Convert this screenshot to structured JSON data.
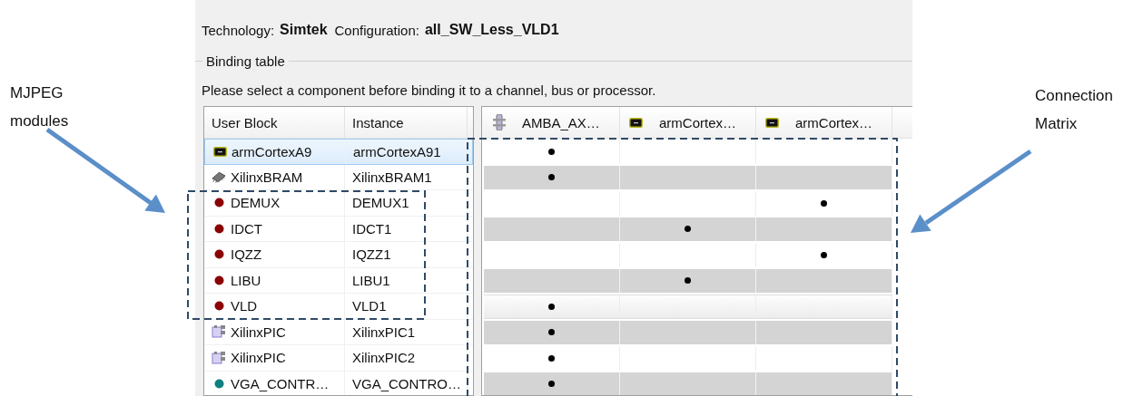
{
  "technology": {
    "label": "Technology:",
    "value": "Simtek"
  },
  "configuration": {
    "label": "Configuration:",
    "value": "all_SW_Less_VLD1"
  },
  "binding_table": {
    "title": "Binding table",
    "instruction": "Please select a component before binding it to a channel, bus or processor.",
    "user_blocks": {
      "columns": [
        "User Block",
        "Instance"
      ],
      "rows": [
        {
          "kind": "processor",
          "block": "armCortexA9",
          "instance": "armCortexA91",
          "selected": true
        },
        {
          "kind": "memory",
          "block": "XilinxBRAM",
          "instance": "XilinxBRAM1",
          "selected": false
        },
        {
          "kind": "module",
          "color": "#8b0000",
          "block": "DEMUX",
          "instance": "DEMUX1",
          "selected": false
        },
        {
          "kind": "module",
          "color": "#8b0000",
          "block": "IDCT",
          "instance": "IDCT1",
          "selected": false
        },
        {
          "kind": "module",
          "color": "#8b0000",
          "block": "IQZZ",
          "instance": "IQZZ1",
          "selected": false
        },
        {
          "kind": "module",
          "color": "#8b0000",
          "block": "LIBU",
          "instance": "LIBU1",
          "selected": false
        },
        {
          "kind": "module",
          "color": "#8b0000",
          "block": "VLD",
          "instance": "VLD1",
          "selected": false
        },
        {
          "kind": "pic",
          "block": "XilinxPIC",
          "instance": "XilinxPIC1",
          "selected": false
        },
        {
          "kind": "pic",
          "block": "XilinxPIC",
          "instance": "XilinxPIC2",
          "selected": false
        },
        {
          "kind": "module",
          "color": "#0f7f7f",
          "block": "VGA_CONTR…",
          "instance": "VGA_CONTRO…",
          "selected": false
        }
      ]
    },
    "matrix": {
      "columns": [
        {
          "kind": "bus",
          "label": "AMBA_AX…"
        },
        {
          "kind": "processor",
          "label": "armCortex…"
        },
        {
          "kind": "processor",
          "label": "armCortex…"
        }
      ],
      "rows": [
        {
          "highlighted": false,
          "bound": [
            true,
            false,
            false
          ]
        },
        {
          "highlighted": false,
          "bound": [
            true,
            false,
            false
          ]
        },
        {
          "highlighted": false,
          "bound": [
            false,
            false,
            true
          ]
        },
        {
          "highlighted": false,
          "bound": [
            false,
            true,
            false
          ]
        },
        {
          "highlighted": false,
          "bound": [
            false,
            false,
            true
          ]
        },
        {
          "highlighted": false,
          "bound": [
            false,
            true,
            false
          ]
        },
        {
          "highlighted": true,
          "bound": [
            true,
            false,
            false
          ]
        },
        {
          "highlighted": false,
          "bound": [
            true,
            false,
            false
          ]
        },
        {
          "highlighted": false,
          "bound": [
            true,
            false,
            false
          ]
        },
        {
          "highlighted": false,
          "bound": [
            true,
            false,
            false
          ]
        }
      ]
    }
  },
  "annotations": [
    {
      "text": "MJPEG modules"
    },
    {
      "text": "Connection Matrix"
    }
  ]
}
